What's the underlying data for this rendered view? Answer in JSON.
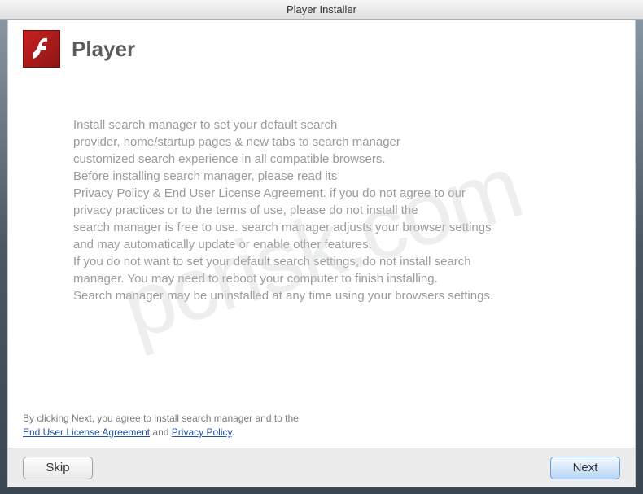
{
  "titlebar": {
    "text": "Player Installer"
  },
  "header": {
    "title": "Player",
    "logo_name": "flash-logo-icon"
  },
  "body": {
    "line1": "Install search manager to set your default search",
    "line2": "provider, home/startup pages & new tabs to search manager",
    "line3": "customized search experience in all compatible browsers.",
    "line4": "Before installing search manager, please read its",
    "line5": "Privacy Policy & End User License Agreement. if you do not agree to our",
    "line6": "privacy practices or to the terms of use, please do not install the",
    "line7": "search manager is free to use. search manager adjusts your browser settings",
    "line8": "and may automatically update or enable other features.",
    "line9": "If you do not want to set your default search settings, do not install search",
    "line10": "manager. You may need to reboot your computer to finish installing.",
    "line11": "Search manager may be uninstalled at any time using your browsers settings."
  },
  "agreement": {
    "prefix": "By clicking Next, you agree to install search manager and to the",
    "eula_link": "End User License Agreement",
    "and": " and ",
    "privacy_link": "Privacy Policy",
    "suffix": "."
  },
  "buttons": {
    "skip": "Skip",
    "next": "Next"
  },
  "watermark": "pcrisk.com"
}
